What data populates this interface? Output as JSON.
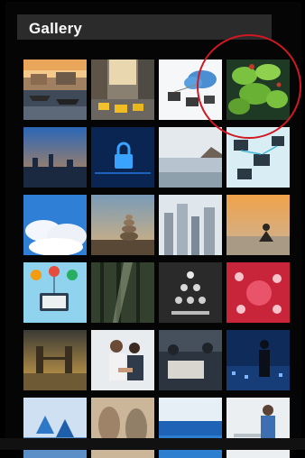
{
  "gallery": {
    "title": "Gallery",
    "images": [
      {
        "icon": "harbor-boats-photo"
      },
      {
        "icon": "city-street-taxis-photo"
      },
      {
        "icon": "cloud-network-photo"
      },
      {
        "icon": "green-plant-photo"
      },
      {
        "icon": "city-skyline-dusk-photo"
      },
      {
        "icon": "digital-lock-photo"
      },
      {
        "icon": "misty-sea-photo"
      },
      {
        "icon": "computer-network-photo"
      },
      {
        "icon": "blue-sky-clouds-photo"
      },
      {
        "icon": "stacked-stones-photo"
      },
      {
        "icon": "skyscrapers-photo"
      },
      {
        "icon": "meditation-sunset-photo"
      },
      {
        "icon": "people-network-illustration"
      },
      {
        "icon": "forest-sunbeams-photo"
      },
      {
        "icon": "human-pyramid-photo"
      },
      {
        "icon": "red-network-photo"
      },
      {
        "icon": "tower-bridge-photo"
      },
      {
        "icon": "business-handshake-photo"
      },
      {
        "icon": "business-meeting-photo"
      },
      {
        "icon": "businessman-night-city-photo"
      },
      {
        "icon": "blue-arrows-photo"
      },
      {
        "icon": "blurred-people-photo"
      },
      {
        "icon": "ocean-horizon-photo"
      },
      {
        "icon": "office-meeting-photo"
      }
    ]
  },
  "highlight": {
    "color": "#d01822",
    "target": "green-plant-photo"
  }
}
